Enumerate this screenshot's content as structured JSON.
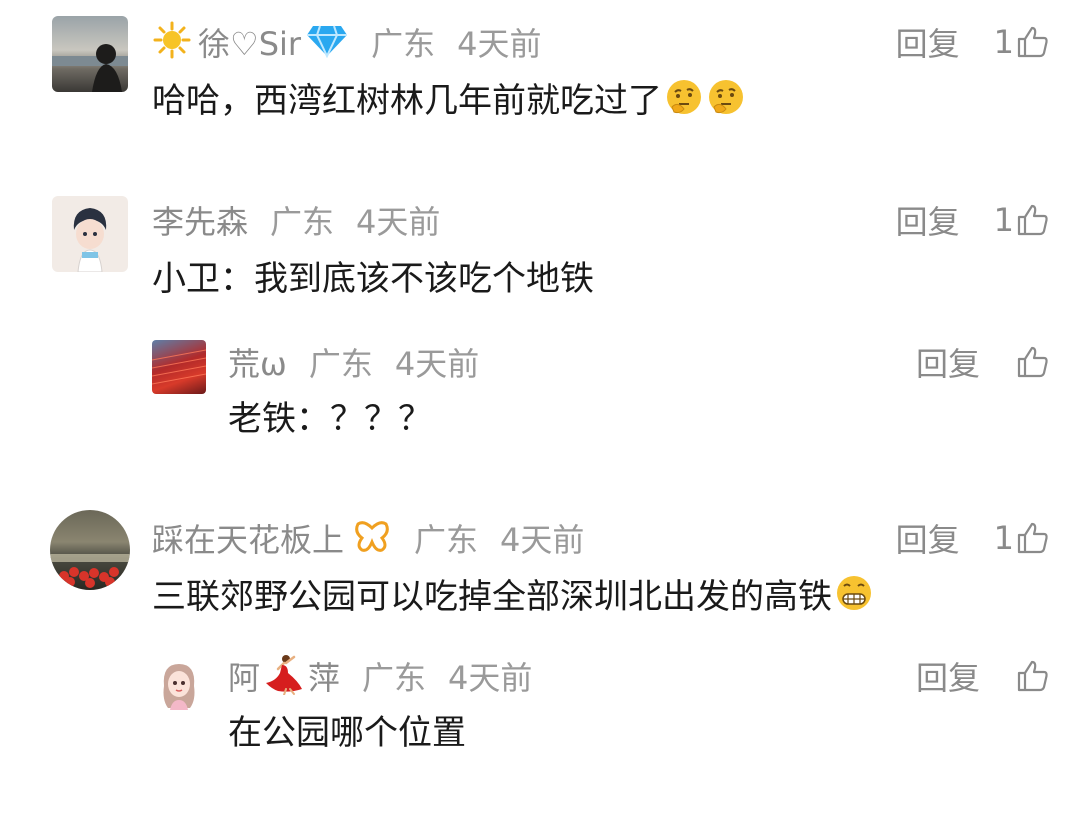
{
  "comments": [
    {
      "name_prefix": "徐♡Sir",
      "location": "广东",
      "time": "4天前",
      "text": "哈哈，西湾红树林几年前就吃过了",
      "reply_label": "回复",
      "likes": "1",
      "emojis": [
        "thinking-emoji",
        "thinking-emoji"
      ]
    },
    {
      "name": "李先森",
      "location": "广东",
      "time": "4天前",
      "text": "小卫：我到底该不该吃个地铁",
      "reply_label": "回复",
      "likes": "1",
      "replies": [
        {
          "name": "荒ω",
          "location": "广东",
          "time": "4天前",
          "text": "老铁：？？？",
          "reply_label": "回复",
          "likes": ""
        }
      ]
    },
    {
      "name": "踩在天花板上",
      "location": "广东",
      "time": "4天前",
      "text": "三联郊野公园可以吃掉全部深圳北出发的高铁",
      "reply_label": "回复",
      "likes": "1",
      "replies": [
        {
          "name_a": "阿",
          "name_b": "萍",
          "location": "广东",
          "time": "4天前",
          "text": "在公园哪个位置",
          "reply_label": "回复",
          "likes": ""
        }
      ]
    }
  ],
  "icons": {
    "like": "thumbs-up-outline-icon",
    "sun": "sun-emoji",
    "diamond": "diamond-badge",
    "butterfly": "butterfly-badge",
    "dancer": "dancer-emoji"
  },
  "colors": {
    "meta_gray": "#8a8a8a",
    "text_dark": "#1a1a1a",
    "diamond_blue": "#2aa8f0",
    "butterfly_gold": "#f0a020"
  }
}
